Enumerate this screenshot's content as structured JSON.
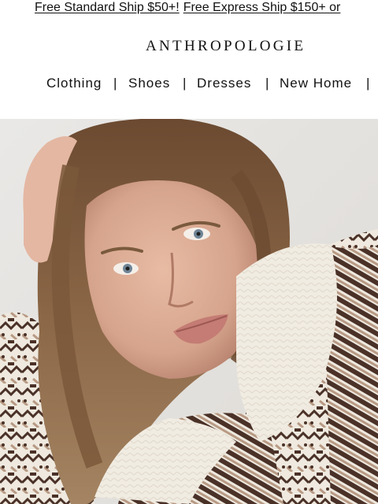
{
  "promo": {
    "standard_ship": "Free Standard Ship $50+!",
    "express_ship": "Free Express Ship $150+ or"
  },
  "brand": {
    "logo_text": "ANTHROPOLOGIE"
  },
  "nav": {
    "items": [
      {
        "label": "Clothing"
      },
      {
        "label": "Shoes"
      },
      {
        "label": "Dresses"
      },
      {
        "label": "New Home"
      }
    ],
    "separator": "|"
  },
  "hero": {
    "image_subject": "model-in-fair-isle-sweater",
    "colors": {
      "background": "#e7e6e3",
      "hair": "#7a5a3c",
      "skin": "#d9aa92",
      "sweater_cream": "#f1ece2",
      "sweater_brown": "#4a3127",
      "sweater_tan": "#b89a84"
    }
  }
}
